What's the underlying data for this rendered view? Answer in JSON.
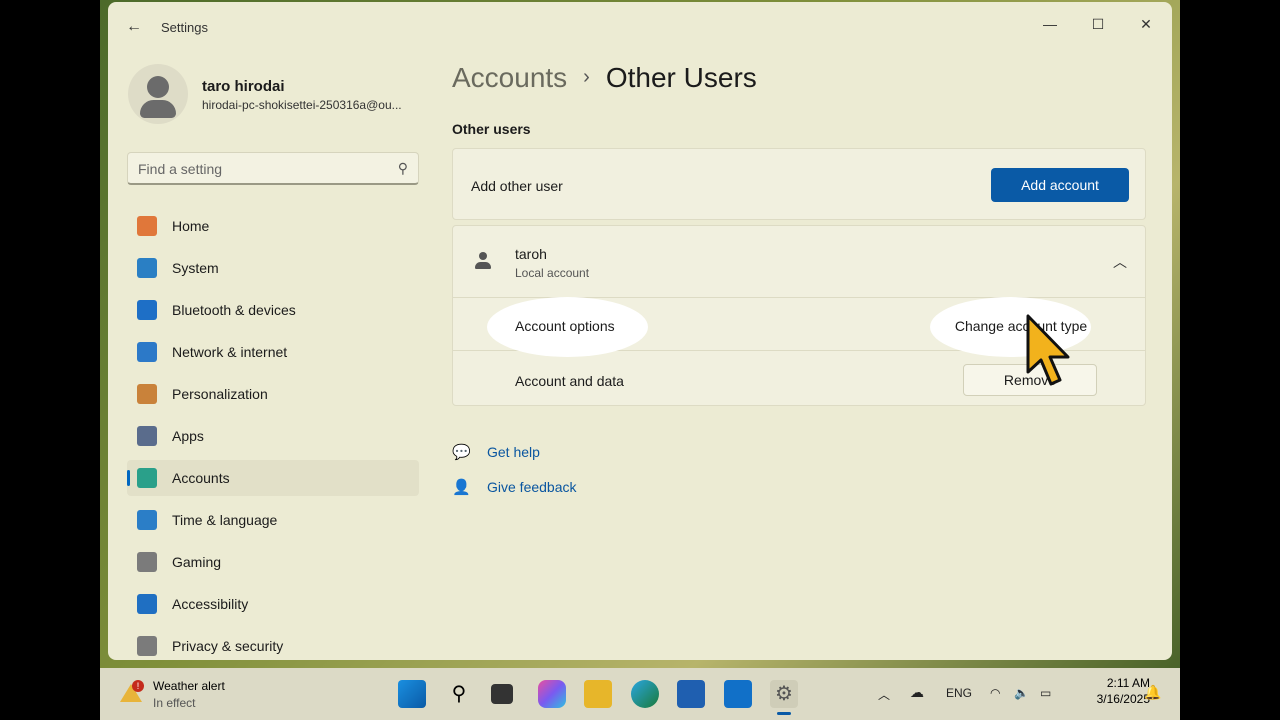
{
  "window": {
    "title": "Settings",
    "back_icon": "arrow-left-icon",
    "controls": [
      "minimize-icon",
      "maximize-icon",
      "close-icon"
    ]
  },
  "profile": {
    "name": "taro hirodai",
    "email": "hirodai-pc-shokisettei-250316a@ou..."
  },
  "search": {
    "placeholder": "Find a setting"
  },
  "nav": {
    "items": [
      {
        "label": "Home",
        "icon": "home-icon",
        "color": "#e0773a"
      },
      {
        "label": "System",
        "icon": "system-icon",
        "color": "#2a7fc4"
      },
      {
        "label": "Bluetooth & devices",
        "icon": "bluetooth-icon",
        "color": "#1e6fc6"
      },
      {
        "label": "Network & internet",
        "icon": "wifi-icon",
        "color": "#2c79c8"
      },
      {
        "label": "Personalization",
        "icon": "brush-icon",
        "color": "#c9823a"
      },
      {
        "label": "Apps",
        "icon": "apps-icon",
        "color": "#5a6c8c"
      },
      {
        "label": "Accounts",
        "icon": "accounts-icon",
        "color": "#2aa08a",
        "active": true
      },
      {
        "label": "Time & language",
        "icon": "clock-globe-icon",
        "color": "#2b7ec7"
      },
      {
        "label": "Gaming",
        "icon": "gamepad-icon",
        "color": "#7b7b7b"
      },
      {
        "label": "Accessibility",
        "icon": "accessibility-icon",
        "color": "#1f6fc2"
      },
      {
        "label": "Privacy & security",
        "icon": "shield-icon",
        "color": "#7b7b7b"
      }
    ]
  },
  "breadcrumb": {
    "parent": "Accounts",
    "separator": "›",
    "current": "Other Users"
  },
  "section": {
    "title": "Other users"
  },
  "add_user": {
    "label": "Add other user",
    "button": "Add account"
  },
  "user": {
    "name": "taroh",
    "type": "Local account",
    "account_options_label": "Account options",
    "change_type_button": "Change account type",
    "account_data_label": "Account and data",
    "remove_button": "Remove"
  },
  "help": {
    "get_help": "Get help",
    "give_feedback": "Give feedback"
  },
  "taskbar": {
    "weather_title": "Weather alert",
    "weather_sub": "In effect",
    "weather_badge": "!",
    "apps": [
      "start-icon",
      "search-icon",
      "task-view-icon",
      "copilot-icon",
      "file-explorer-icon",
      "edge-icon",
      "store-icon",
      "outlook-icon",
      "settings-icon"
    ],
    "language": "ENG",
    "time": "2:11 AM",
    "date": "3/16/2025"
  },
  "colors": {
    "accent": "#0a5aa6",
    "link": "#0a56a0"
  }
}
